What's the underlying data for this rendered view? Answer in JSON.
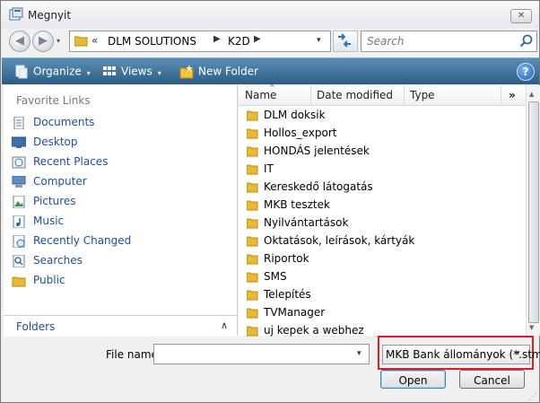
{
  "window": {
    "title": "Megnyit",
    "close_glyph": "✕"
  },
  "nav": {
    "back_glyph": "◀",
    "forward_glyph": "▶",
    "history_glyph": "▾"
  },
  "address": {
    "chevron": "«",
    "segments": [
      "DLM SOLUTIONS",
      "K2D"
    ],
    "separator": "▶",
    "dropdown_glyph": "▾"
  },
  "search": {
    "placeholder": "Search"
  },
  "toolbar": {
    "organize_label": "Organize",
    "views_label": "Views",
    "new_folder_label": "New Folder",
    "dropdown_glyph": "▾",
    "help_label": "?"
  },
  "favorites": {
    "title": "Favorite Links",
    "items": [
      {
        "label": "Documents",
        "icon": "documents-icon"
      },
      {
        "label": "Desktop",
        "icon": "desktop-icon"
      },
      {
        "label": "Recent Places",
        "icon": "recent-places-icon"
      },
      {
        "label": "Computer",
        "icon": "computer-icon"
      },
      {
        "label": "Pictures",
        "icon": "pictures-icon"
      },
      {
        "label": "Music",
        "icon": "music-icon"
      },
      {
        "label": "Recently Changed",
        "icon": "recently-changed-icon"
      },
      {
        "label": "Searches",
        "icon": "searches-icon"
      },
      {
        "label": "Public",
        "icon": "public-folder-icon"
      }
    ]
  },
  "folders_bar": {
    "label": "Folders",
    "chevron": "∧"
  },
  "columns": {
    "name": "Name",
    "date": "Date modified",
    "type": "Type",
    "more": "»",
    "sort_glyph": "^"
  },
  "files": [
    "DLM doksik",
    "Hollos_export",
    "HONDÁS jelentések",
    "IT",
    "Kereskedő látogatás",
    "MKB tesztek",
    "Nyilvántartások",
    "Oktatások, leírások, kártyák",
    "Riportok",
    "SMS",
    "Telepítés",
    "TVManager",
    "uj kepek a webhez"
  ],
  "scrollbar": {
    "up_glyph": "▲",
    "down_glyph": "▼"
  },
  "filename": {
    "label": "File name:",
    "value": "",
    "dropdown_glyph": "▾"
  },
  "filter": {
    "value": "MKB Bank állományok (*.stm)",
    "dropdown_glyph": "▾"
  },
  "buttons": {
    "open": "Open",
    "cancel": "Cancel"
  },
  "colors": {
    "toolbar_top": "#5b8fb5",
    "toolbar_bottom": "#2b5d84",
    "link": "#1f4e9c",
    "folder": "#e8b931",
    "highlight_border": "#e01a22"
  }
}
